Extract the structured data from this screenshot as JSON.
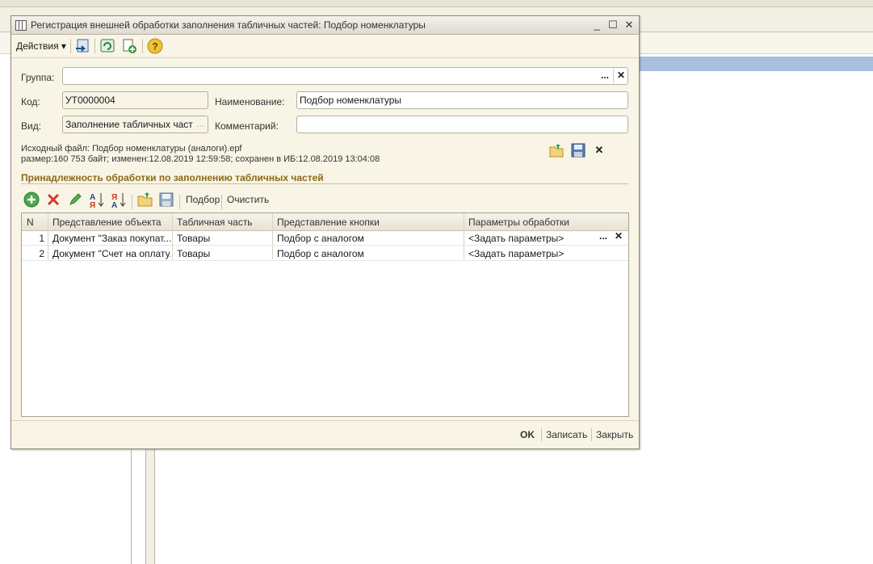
{
  "window": {
    "title": "Регистрация внешней обработки заполнения табличных частей: Подбор номенклатуры",
    "minimize": "_",
    "maximize": "☐",
    "close": "✕"
  },
  "toolbar": {
    "actions_label": "Действия",
    "dropdown_arrow": "▾",
    "help": "?"
  },
  "form": {
    "group_label": "Группа:",
    "group_value": "",
    "code_label": "Код:",
    "code_value": "УТ0000004",
    "name_label": "Наименование:",
    "name_value": "Подбор номенклатуры",
    "kind_label": "Вид:",
    "kind_value": "Заполнение табличных частей",
    "comment_label": "Комментарий:",
    "comment_value": "",
    "ellipsis": "...",
    "clear": "✕"
  },
  "file_info": {
    "line1": "Исходный файл: Подбор номенклатуры (аналоги).epf",
    "line2": "размер:160 753 байт; изменен:12.08.2019 12:59:58; сохранен в ИБ:12.08.2019 13:04:08"
  },
  "section": {
    "title": "Принадлежность обработки по заполнению табличных частей",
    "pick_label": "Подбор",
    "clear_label": "Очистить"
  },
  "table": {
    "columns": [
      "N",
      "Представление объекта",
      "Табличная часть",
      "Представление кнопки",
      "Параметры обработки"
    ],
    "rows": [
      [
        "1",
        "Документ \"Заказ покупат...",
        "Товары",
        "Подбор с аналогом",
        "<Задать параметры>"
      ],
      [
        "2",
        "Документ \"Счет на оплату...",
        "Товары",
        "Подбор с аналогом",
        "<Задать параметры>"
      ]
    ]
  },
  "footer": {
    "ok": "OK",
    "save": "Записать",
    "close": "Закрыть"
  },
  "colors": {
    "window_bg": "#f8f4e6",
    "section_title": "#8a6a14",
    "selection": "#a8c0dd"
  }
}
